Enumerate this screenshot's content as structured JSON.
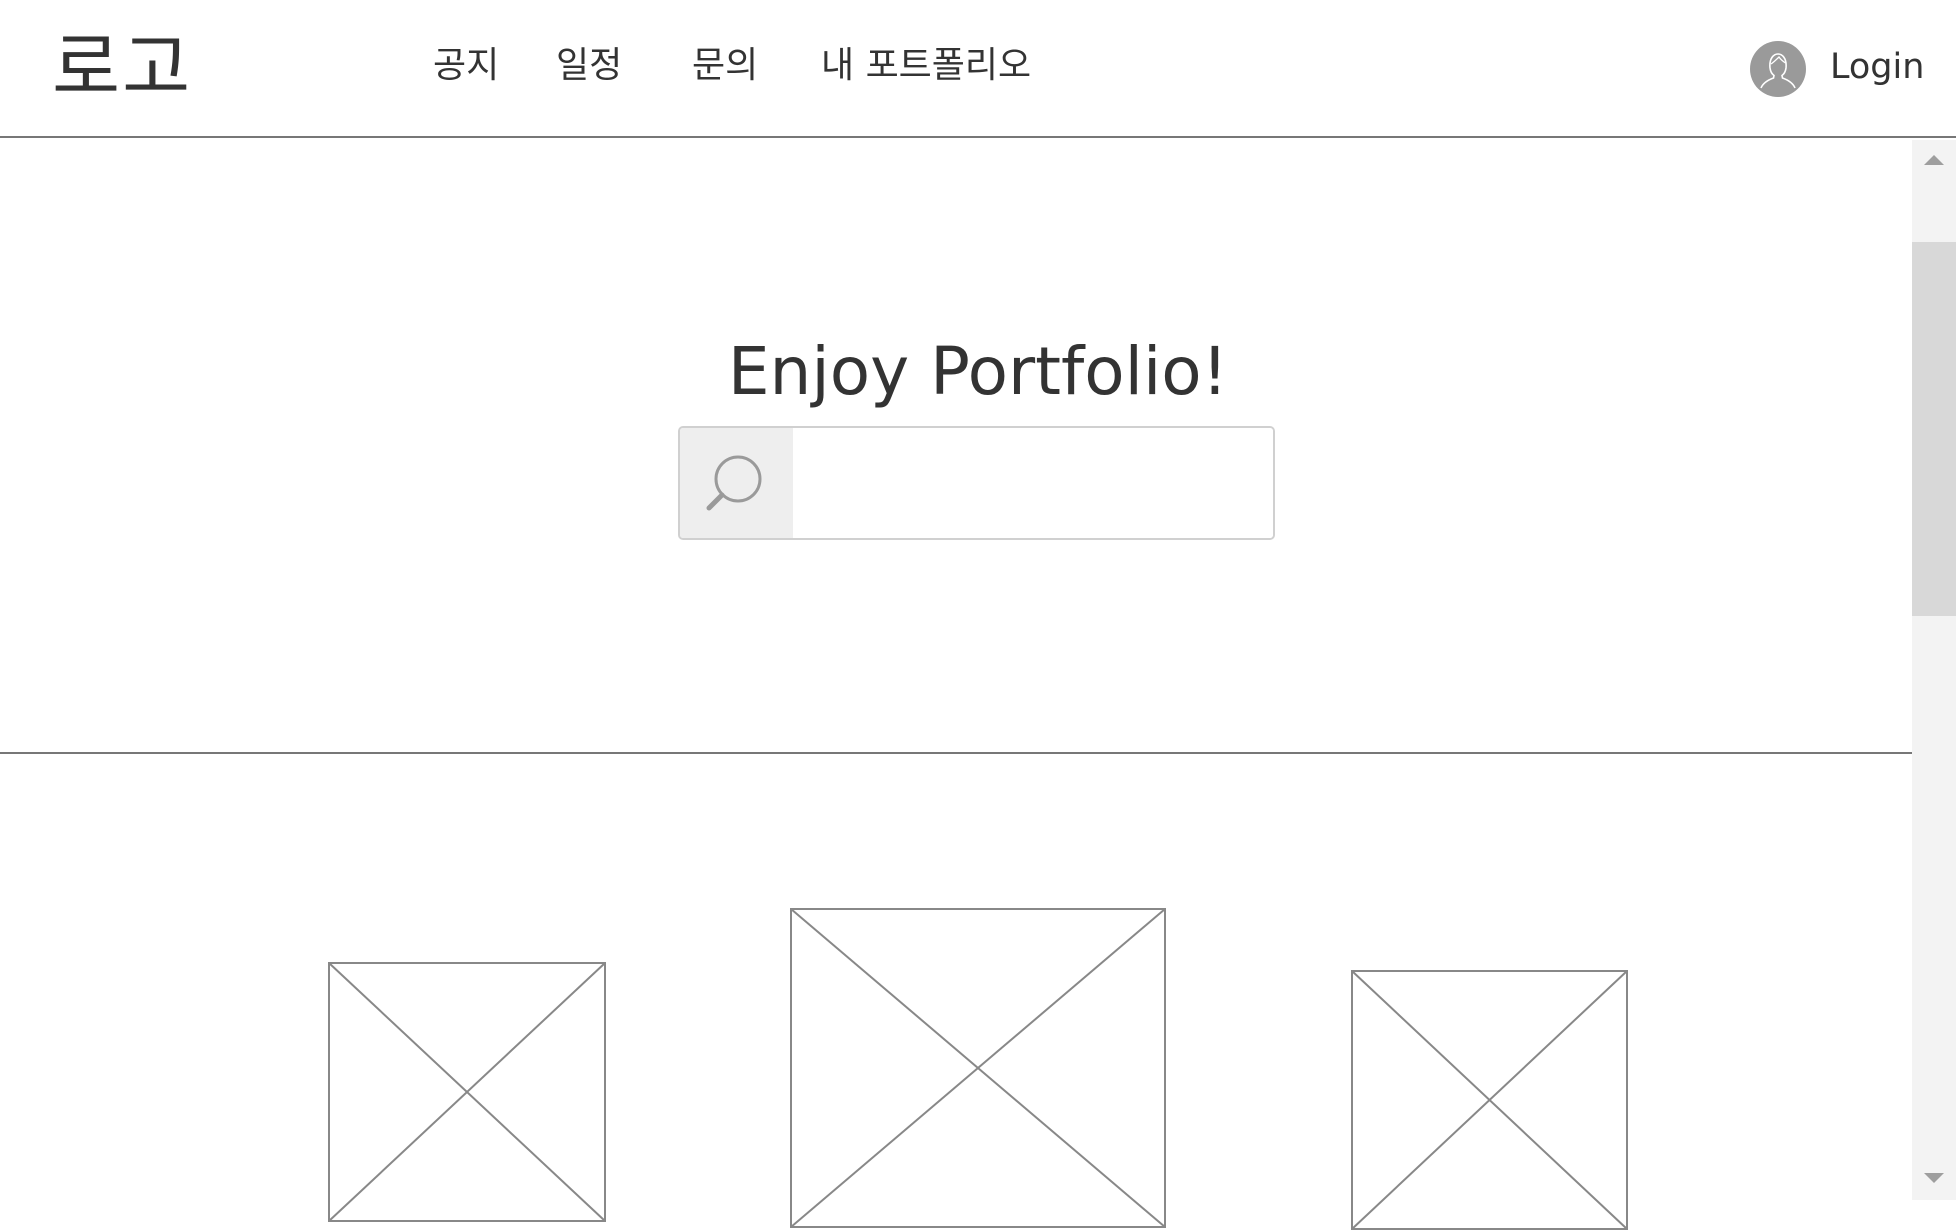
{
  "header": {
    "logo": "로고",
    "nav": [
      {
        "label": "공지"
      },
      {
        "label": "일정"
      },
      {
        "label": "문의"
      },
      {
        "label": "내 포트폴리오"
      }
    ],
    "login_label": "Login"
  },
  "hero": {
    "title": "Enjoy Portfolio!",
    "search": {
      "value": "",
      "placeholder": ""
    }
  },
  "gallery": {
    "items": [
      {
        "icon": "image-placeholder-icon"
      },
      {
        "icon": "image-placeholder-icon"
      },
      {
        "icon": "image-placeholder-icon"
      }
    ]
  },
  "icons": {
    "search": "search-icon",
    "avatar": "user-avatar-icon",
    "scroll_up": "chevron-up-icon",
    "scroll_down": "chevron-down-icon"
  },
  "colors": {
    "text": "#333333",
    "divider": "#777777",
    "avatar_bg": "#9a9a9a",
    "search_button_bg": "#eeeeee",
    "scroll_track": "#f3f3f3",
    "scroll_thumb": "#d8d8d8"
  }
}
